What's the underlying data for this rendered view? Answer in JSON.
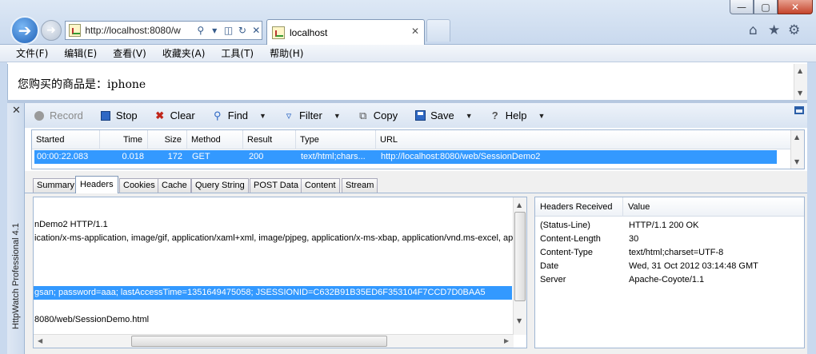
{
  "browser": {
    "address": "http://localhost:8080/w",
    "tab_title": "localhost",
    "window_buttons": [
      "—",
      "▢",
      "✕"
    ]
  },
  "menu": [
    "文件(F)",
    "编辑(E)",
    "查看(V)",
    "收藏夹(A)",
    "工具(T)",
    "帮助(H)"
  ],
  "page": {
    "text": "您购买的商品是：iphone"
  },
  "httpwatch": {
    "title": "HttpWatch Professional 4.1",
    "toolbar": {
      "record": "Record",
      "stop": "Stop",
      "clear": "Clear",
      "find": "Find",
      "filter": "Filter",
      "copy": "Copy",
      "save": "Save",
      "help": "Help"
    },
    "grid": {
      "columns": [
        "Started",
        "Time",
        "Size",
        "Method",
        "Result",
        "Type",
        "URL"
      ],
      "row": {
        "started": "00:00:22.083",
        "time": "0.018",
        "size": "172",
        "method": "GET",
        "result": "200",
        "type": "text/html;chars...",
        "url": "http://localhost:8080/web/SessionDemo2"
      }
    },
    "detail_tabs": [
      "Summary",
      "Headers",
      "Cookies",
      "Cache",
      "Query String",
      "POST Data",
      "Content",
      "Stream"
    ],
    "active_tab": "Headers",
    "raw_lines": [
      "nDemo2 HTTP/1.1",
      "ication/x-ms-application, image/gif, application/xaml+xml, image/pjpeg, application/x-ms-xbap, application/vnd.ms-excel, ap",
      "",
      "",
      "",
      "gsan; password=aaa; lastAccessTime=1351649475058; JSESSIONID=C632B91B35ED6F353104F7CCD7D0BAA5",
      "",
      "8080/web/SessionDemo.html"
    ],
    "headers_table": {
      "col_name": "Headers Received",
      "col_value": "Value",
      "rows": [
        {
          "name": "(Status-Line)",
          "value": "HTTP/1.1 200 OK"
        },
        {
          "name": "Content-Length",
          "value": "30"
        },
        {
          "name": "Content-Type",
          "value": "text/html;charset=UTF-8"
        },
        {
          "name": "Date",
          "value": "Wed, 31 Oct 2012 03:14:48 GMT"
        },
        {
          "name": "Server",
          "value": "Apache-Coyote/1.1"
        }
      ]
    }
  },
  "colors": {
    "selection": "#3399ff",
    "chrome": "#c9d9ee",
    "accent": "#1d5fb6"
  }
}
